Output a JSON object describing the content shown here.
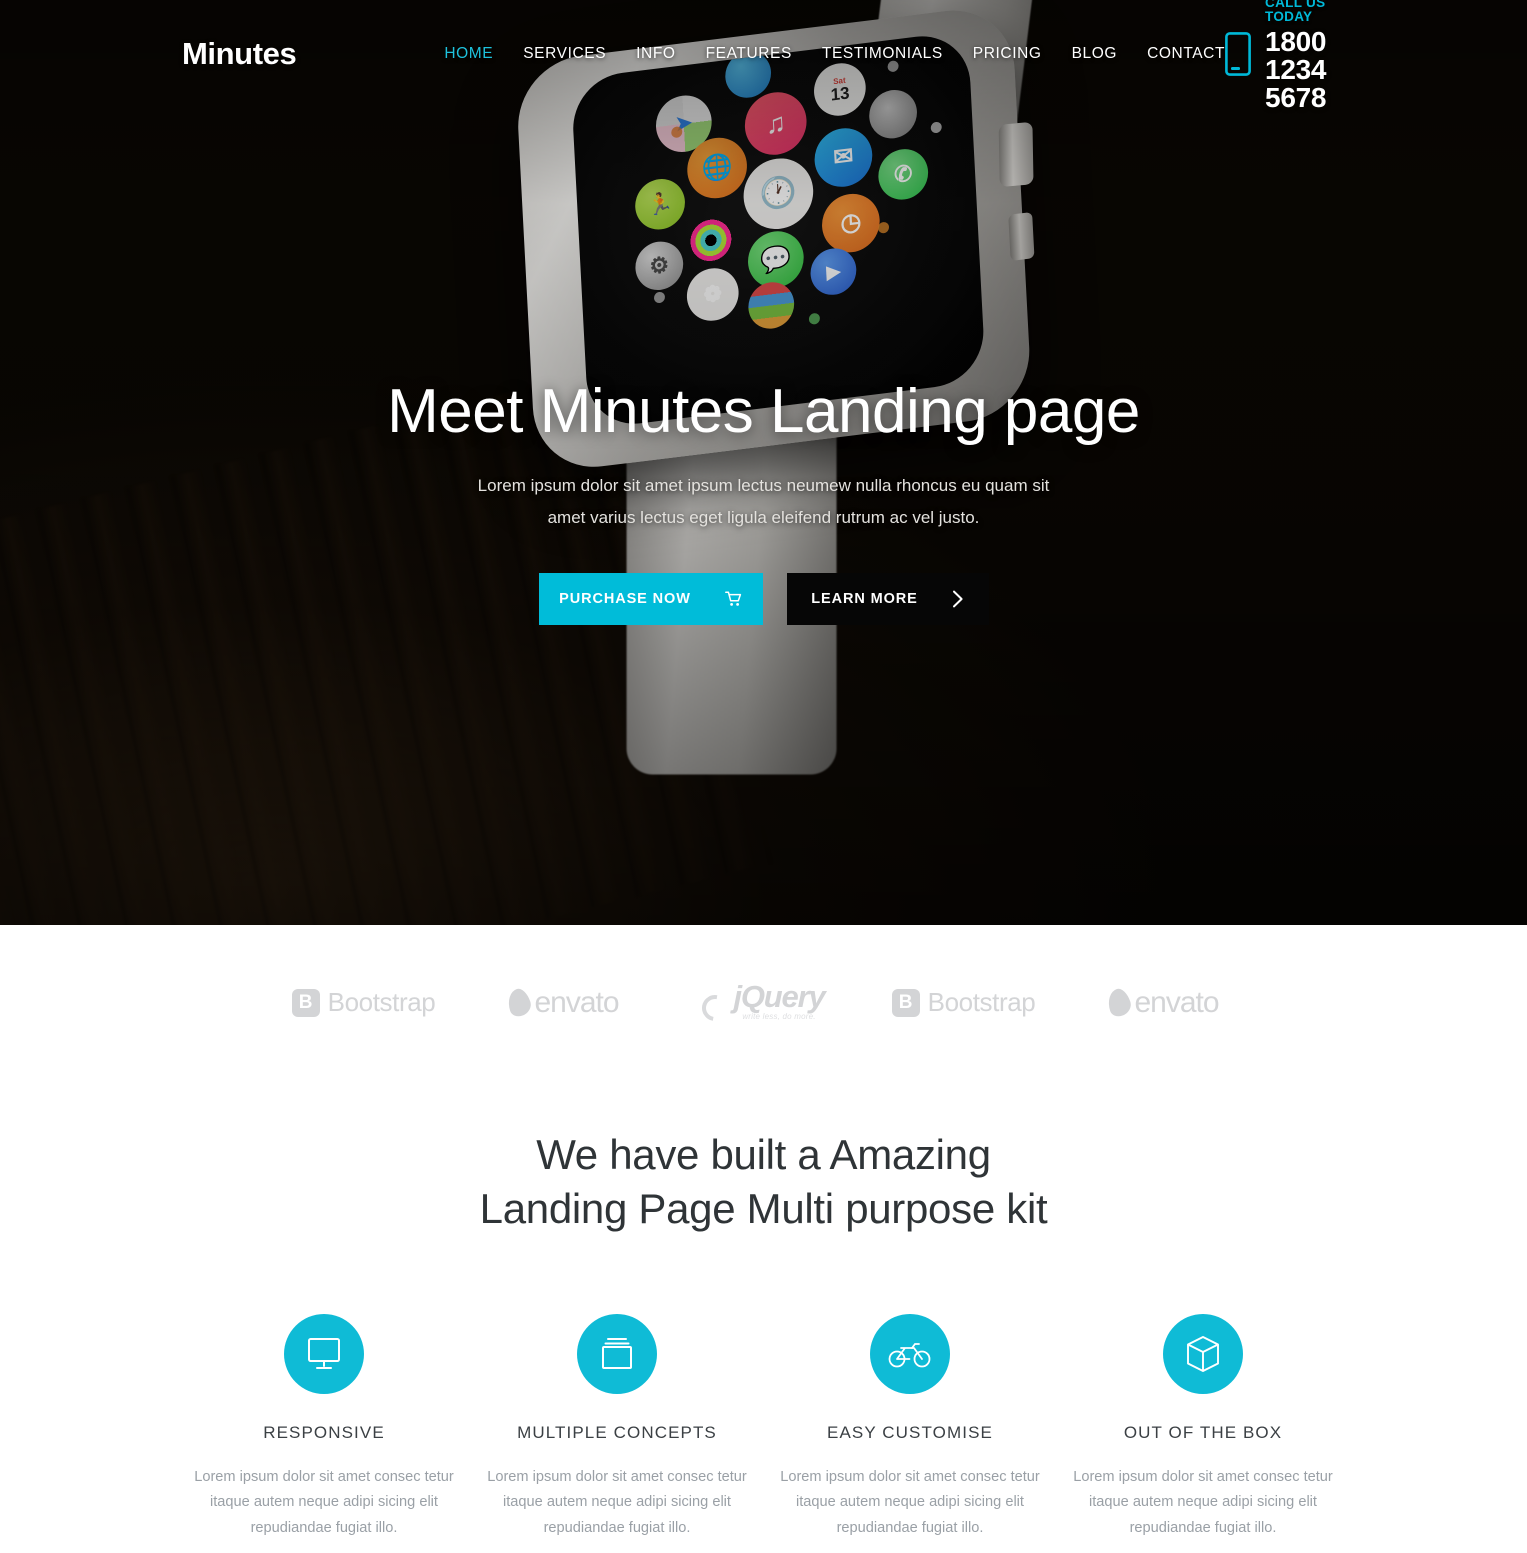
{
  "header": {
    "logo": "Minutes",
    "nav": [
      {
        "label": "HOME",
        "active": true
      },
      {
        "label": "SERVICES",
        "active": false
      },
      {
        "label": "INFO",
        "active": false
      },
      {
        "label": "FEATURES",
        "active": false
      },
      {
        "label": "TESTIMONIALS",
        "active": false
      },
      {
        "label": "PRICING",
        "active": false
      },
      {
        "label": "BLOG",
        "active": false
      },
      {
        "label": "CONTACT",
        "active": false
      }
    ],
    "call": {
      "icon": "mobile-phone-icon",
      "label": "CALL US TODAY",
      "number": "1800 1234 5678"
    }
  },
  "hero": {
    "title": "Meet Minutes Landing page",
    "subtitle_line1": "Lorem ipsum dolor sit amet ipsum lectus neumew nulla rhoncus eu quam sit",
    "subtitle_line2": "amet varius lectus eget ligula eleifend rutrum ac vel justo.",
    "primary_button": {
      "label": "PURCHASE NOW",
      "icon": "shopping-cart-icon"
    },
    "secondary_button": {
      "label": "LEARN MORE",
      "icon": "chevron-right-icon"
    },
    "image_alt": "Apple Watch on wrist showing app grid"
  },
  "logos": [
    {
      "name": "Bootstrap",
      "icon": "bootstrap-logo"
    },
    {
      "name": "envato",
      "icon": "envato-logo"
    },
    {
      "name": "jQuery",
      "tagline": "write less, do more.",
      "icon": "jquery-logo"
    },
    {
      "name": "Bootstrap",
      "icon": "bootstrap-logo"
    },
    {
      "name": "envato",
      "icon": "envato-logo"
    }
  ],
  "features_section": {
    "title_line1": "We have built a Amazing",
    "title_line2": "Landing Page Multi purpose kit",
    "items": [
      {
        "icon": "monitor-icon",
        "title": "RESPONSIVE",
        "desc": "Lorem ipsum dolor sit amet consec tetur itaque autem neque adipi sicing elit repudiandae fugiat illo."
      },
      {
        "icon": "windows-stack-icon",
        "title": "MULTIPLE CONCEPTS",
        "desc": "Lorem ipsum dolor sit amet consec tetur itaque autem neque adipi sicing elit repudiandae fugiat illo."
      },
      {
        "icon": "bicycle-icon",
        "title": "EASY CUSTOMISE",
        "desc": "Lorem ipsum dolor sit amet consec tetur itaque autem neque adipi sicing elit repudiandae fugiat illo."
      },
      {
        "icon": "cube-box-icon",
        "title": "OUT OF THE BOX",
        "desc": "Lorem ipsum dolor sit amet consec tetur itaque autem neque adipi sicing elit repudiandae fugiat illo."
      }
    ]
  },
  "colors": {
    "accent_cyan": "#00bcd9",
    "feature_circle": "#0fbbd6",
    "nav_active": "#1ec2dd",
    "call_label": "#00b9d8",
    "dark_button": "#060606",
    "heading": "#2f3437",
    "body_text": "#9aa0a6",
    "logo_gray": "#d3d4d6"
  }
}
